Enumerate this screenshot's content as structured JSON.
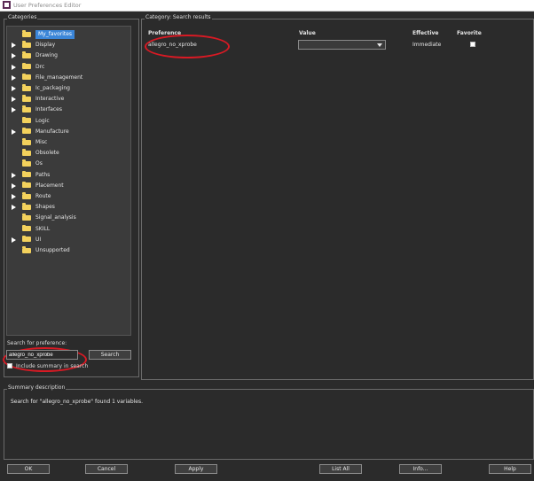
{
  "window": {
    "title": "User Preferences Editor"
  },
  "categories": {
    "label": "Categories",
    "items": [
      {
        "name": "My_favorites",
        "has_children": false,
        "selected": true
      },
      {
        "name": "Display",
        "has_children": true
      },
      {
        "name": "Drawing",
        "has_children": true
      },
      {
        "name": "Drc",
        "has_children": true
      },
      {
        "name": "File_management",
        "has_children": true
      },
      {
        "name": "Ic_packaging",
        "has_children": true
      },
      {
        "name": "Interactive",
        "has_children": true
      },
      {
        "name": "Interfaces",
        "has_children": true
      },
      {
        "name": "Logic",
        "has_children": false
      },
      {
        "name": "Manufacture",
        "has_children": true
      },
      {
        "name": "Misc",
        "has_children": false
      },
      {
        "name": "Obsolete",
        "has_children": false
      },
      {
        "name": "Os",
        "has_children": false
      },
      {
        "name": "Paths",
        "has_children": true
      },
      {
        "name": "Placement",
        "has_children": true
      },
      {
        "name": "Route",
        "has_children": true
      },
      {
        "name": "Shapes",
        "has_children": true
      },
      {
        "name": "Signal_analysis",
        "has_children": false
      },
      {
        "name": "SKILL",
        "has_children": false
      },
      {
        "name": "UI",
        "has_children": true
      },
      {
        "name": "Unsupported",
        "has_children": false
      }
    ]
  },
  "search": {
    "label": "Search for preference:",
    "value": "allegro_no_xprobe",
    "button": "Search",
    "include_summary_label": "Include summary in search"
  },
  "results": {
    "category_label": "Category:",
    "category_value": "Search results",
    "columns": {
      "preference": "Preference",
      "value": "Value",
      "effective": "Effective",
      "favorite": "Favorite"
    },
    "rows": [
      {
        "preference": "allegro_no_xprobe",
        "value": "",
        "effective": "Immediate",
        "favorite": false
      }
    ]
  },
  "summary": {
    "label": "Summary description",
    "text": "Search for \"allegro_no_xprobe\" found 1 variables."
  },
  "buttons": {
    "ok": "OK",
    "cancel": "Cancel",
    "apply": "Apply",
    "list_all": "List All",
    "info": "Info...",
    "help": "Help"
  },
  "annotation_color": "#d81a24"
}
